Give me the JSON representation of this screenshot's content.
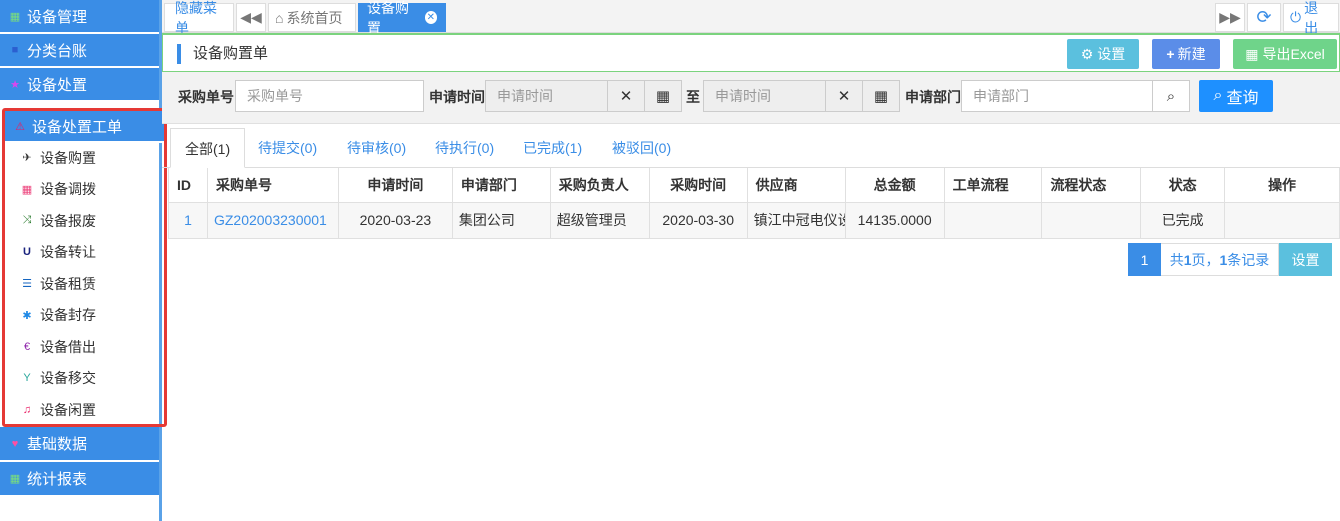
{
  "sidebar": {
    "items_top": [
      {
        "label": "设备管理",
        "icon": "grid-icon",
        "icon_color": "#7be07b"
      },
      {
        "label": "分类台账",
        "icon": "square-icon",
        "icon_color": "#2b5fd0"
      },
      {
        "label": "设备处置",
        "icon": "star-icon",
        "icon_color": "#d946ef"
      }
    ],
    "group": {
      "label": "设备处置工单",
      "icon": "warning-icon",
      "icon_color": "#e91e63"
    },
    "subitems": [
      {
        "label": "设备购置",
        "icon": "plane-icon",
        "glyph": "✈",
        "color": "#333"
      },
      {
        "label": "设备调拨",
        "icon": "calendar-icon",
        "glyph": "▦",
        "color": "#ec407a"
      },
      {
        "label": "设备报废",
        "icon": "random-icon",
        "glyph": "⤨",
        "color": "#2e7d32"
      },
      {
        "label": "设备转让",
        "icon": "magnet-icon",
        "glyph": "U",
        "color": "#1a237e"
      },
      {
        "label": "设备租赁",
        "icon": "list-icon",
        "glyph": "☰",
        "color": "#1565c0"
      },
      {
        "label": "设备封存",
        "icon": "asterisk-icon",
        "glyph": "✱",
        "color": "#1e88e5"
      },
      {
        "label": "设备借出",
        "icon": "euro-icon",
        "glyph": "€",
        "color": "#8e24aa"
      },
      {
        "label": "设备移交",
        "icon": "filter-icon",
        "glyph": "Y",
        "color": "#26a69a"
      },
      {
        "label": "设备闲置",
        "icon": "music-icon",
        "glyph": "♫",
        "color": "#e91e63"
      }
    ],
    "items_bottom": [
      {
        "label": "基础数据",
        "icon": "heart-icon",
        "icon_color": "#ff4fa3"
      },
      {
        "label": "统计报表",
        "icon": "grid-icon",
        "icon_color": "#7be07b"
      }
    ]
  },
  "tabbar": {
    "hide_menu": "隐藏菜单",
    "home": "系统首页",
    "active_tab": "设备购置",
    "logout": "退出"
  },
  "panel": {
    "title": "设备购置单",
    "settings_btn": "设置",
    "new_btn": "新建",
    "export_btn": "导出Excel"
  },
  "filters": {
    "order_no_label": "采购单号",
    "order_no_placeholder": "采购单号",
    "apply_time_label": "申请时间",
    "date_from_placeholder": "申请时间",
    "to_label": "至",
    "date_to_placeholder": "申请时间",
    "dept_label": "申请部门",
    "dept_placeholder": "申请部门",
    "query_btn": "查询"
  },
  "status_tabs": [
    "全部(1)",
    "待提交(0)",
    "待审核(0)",
    "待执行(0)",
    "已完成(1)",
    "被驳回(0)"
  ],
  "table": {
    "headers": [
      "ID",
      "采购单号",
      "申请时间",
      "申请部门",
      "采购负责人",
      "采购时间",
      "供应商",
      "总金额",
      "工单流程",
      "流程状态",
      "状态",
      "操作"
    ],
    "rows": [
      [
        "1",
        "GZ202003230001",
        "2020-03-23",
        "集团公司",
        "超级管理员",
        "2020-03-30",
        "镇江中冠电仪设",
        "14135.0000",
        "",
        "",
        "已完成",
        ""
      ]
    ]
  },
  "pager": {
    "page": "1",
    "summary_prefix": "共",
    "total_pages": "1",
    "summary_mid": "页，",
    "total_records": "1",
    "summary_suffix": "条记录",
    "settings": "设置"
  },
  "colors": {
    "accent": "#3a8de6",
    "settings_btn": "#5bc0de",
    "new_btn": "#5b8de8",
    "export_btn": "#6fd48a",
    "query_btn": "#1e90ff"
  }
}
